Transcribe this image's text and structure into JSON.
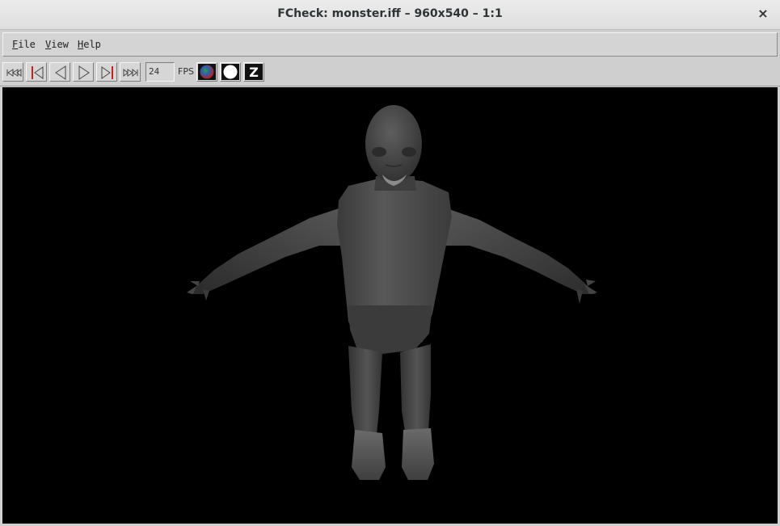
{
  "window": {
    "title": "FCheck: monster.iff – 960x540 – 1:1",
    "close_glyph": "×"
  },
  "menubar": {
    "items": [
      {
        "first": "F",
        "rest": "ile"
      },
      {
        "first": "V",
        "rest": "iew"
      },
      {
        "first": "H",
        "rest": "elp"
      }
    ]
  },
  "toolbar": {
    "buttons": [
      "first-frame-icon",
      "previous-frame-icon",
      "play-reverse-icon",
      "play-forward-icon",
      "next-frame-icon",
      "last-frame-icon"
    ],
    "fps_value": "24",
    "fps_label": "FPS",
    "channel_buttons": [
      "rgb-channel-icon",
      "alpha-channel-icon",
      "depth-channel-icon"
    ],
    "depth_label": "Z"
  },
  "viewport": {
    "image": "monster-render",
    "background": "#000000"
  }
}
